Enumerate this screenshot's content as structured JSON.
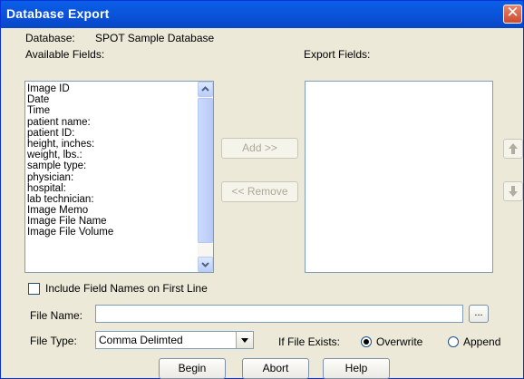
{
  "window": {
    "title": "Database Export",
    "close_glyph": "✕"
  },
  "database": {
    "label": "Database:",
    "value": "SPOT Sample Database"
  },
  "available": {
    "label": "Available Fields:",
    "items": [
      "Image ID",
      "Date",
      "Time",
      "patient name:",
      "patient ID:",
      "height, inches:",
      "weight, lbs.:",
      "sample type:",
      "physician:",
      "hospital:",
      "lab technician:",
      "Image Memo",
      "Image File Name",
      "Image File Volume"
    ]
  },
  "export": {
    "label": "Export Fields:"
  },
  "buttons": {
    "add": "Add >>",
    "remove": "<< Remove",
    "begin": "Begin",
    "abort": "Abort",
    "help": "Help",
    "browse": "..."
  },
  "options": {
    "include_names": "Include Field Names on First Line",
    "include_names_checked": false
  },
  "file": {
    "name_label": "File Name:",
    "name_value": "",
    "type_label": "File Type:",
    "type_value": "Comma Delimted"
  },
  "exists": {
    "label": "If File Exists:",
    "overwrite": "Overwrite",
    "append": "Append",
    "selected": "Overwrite"
  },
  "colors": {
    "title_bar": "#0a55dc",
    "window_bg": "#ece9d8",
    "close_button": "#d9593c"
  },
  "icons": {
    "move_up": "arrow-up-icon",
    "move_down": "arrow-down-icon",
    "dropdown": "chevron-down-icon"
  }
}
